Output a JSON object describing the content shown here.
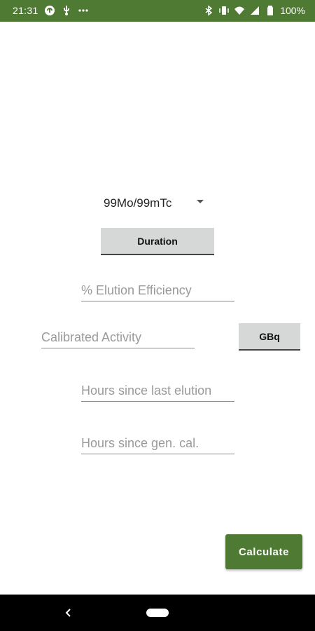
{
  "status_bar": {
    "time": "21:31",
    "battery_text": "100%",
    "left_icons": [
      "sync-icon",
      "usb-debug-icon",
      "more-notifications-icon"
    ],
    "right_icons": [
      "bluetooth-icon",
      "vibrate-icon",
      "wifi-icon",
      "signal-icon",
      "battery-icon"
    ]
  },
  "form": {
    "isotope_select": {
      "value": "99Mo/99mTc"
    },
    "duration_button": {
      "label": "Duration"
    },
    "elution_efficiency": {
      "value": "",
      "placeholder": "% Elution Efficiency"
    },
    "calibrated_activity": {
      "value": "",
      "placeholder": "Calibrated Activity"
    },
    "unit_button": {
      "label": "GBq"
    },
    "hours_since_last_elution": {
      "value": "",
      "placeholder": "Hours since last elution"
    },
    "hours_since_gen_cal": {
      "value": "",
      "placeholder": "Hours since gen. cal."
    },
    "calculate_button": {
      "label": "Calculate"
    }
  },
  "colors": {
    "accent": "#4f7a34",
    "button_gray": "#d6d7d7",
    "nav_bar": "#000000"
  }
}
